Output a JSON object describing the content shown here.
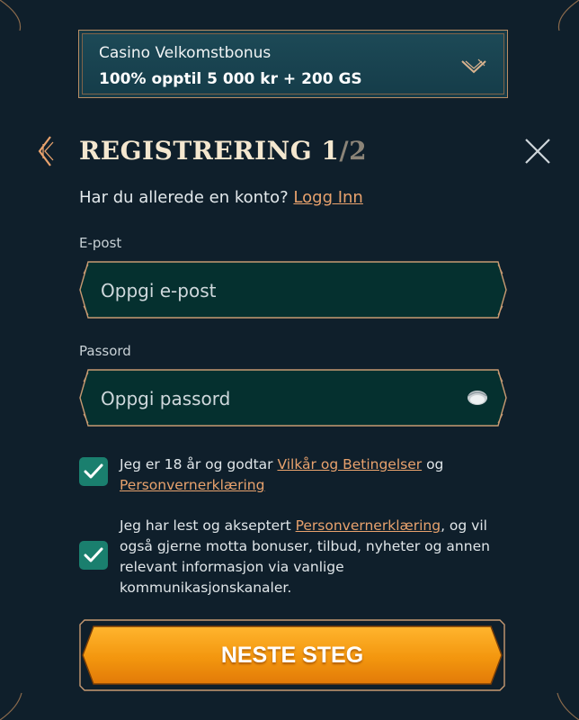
{
  "bonus": {
    "title": "Casino Velkomstbonus",
    "offer": "100% opptil 5 000 kr + 200 GS",
    "icon": "chevron-down-icon"
  },
  "header": {
    "title_main": "Registrering 1",
    "title_sep": "/",
    "title_total": "2",
    "back_icon": "chevron-left-icon",
    "close_icon": "close-icon"
  },
  "login_prompt": {
    "text": "Har du allerede en konto?",
    "link": "Logg Inn"
  },
  "email": {
    "label": "E-post",
    "placeholder": "Oppgi e-post",
    "value": ""
  },
  "password": {
    "label": "Passord",
    "placeholder": "Oppgi passord",
    "value": "",
    "icon": "eye-icon"
  },
  "consent_terms": {
    "checked": true,
    "text_before": "Jeg er 18 år og godtar",
    "link1": "Vilkår og Betingelser",
    "text_mid": "og",
    "link2": "Personvernerklæring"
  },
  "consent_marketing": {
    "checked": true,
    "text_before": "Jeg har lest og akseptert",
    "link": "Personvernerklæring",
    "text_after": ", og vil også gjerne motta bonuser, tilbud, nyheter og annen relevant informasjon via vanlige kommunikasjonskanaler."
  },
  "submit": {
    "label": "NESTE STEG"
  },
  "colors": {
    "background": "#0f1f2b",
    "accent": "#e8a26d",
    "checkbox": "#1a7f6e",
    "cta": "#f59a12",
    "field_bg": "#05302f"
  }
}
